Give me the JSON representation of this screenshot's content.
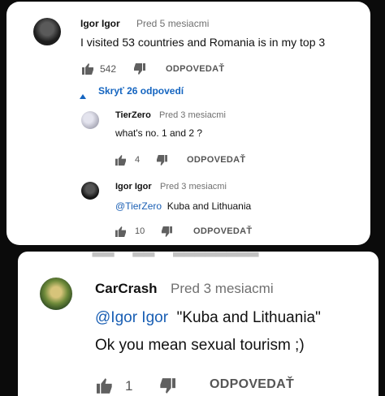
{
  "comment": {
    "author": "Igor Igor",
    "time": "Pred 5 mesiacmi",
    "text": "I visited 53 countries and Romania is in my top 3",
    "likes": "542",
    "reply_label": "ODPOVEDAŤ"
  },
  "replies_toggle": {
    "label": "Skryť 26 odpovedí"
  },
  "replies": [
    {
      "author": "TierZero",
      "time": "Pred 3 mesiacmi",
      "text": "what's no. 1 and 2 ?",
      "likes": "4",
      "reply_label": "ODPOVEDAŤ"
    },
    {
      "author": "Igor Igor",
      "time": "Pred 3 mesiacmi",
      "mention": "@TierZero",
      "text": "Kuba and Lithuania",
      "likes": "10",
      "reply_label": "ODPOVEDAŤ"
    }
  ],
  "second_comment": {
    "author": "CarCrash",
    "time": "Pred 3 mesiacmi",
    "mention": "@Igor Igor",
    "quote": "\"Kuba and Lithuania\"",
    "text": "Ok you mean sexual tourism ;)",
    "likes": "1",
    "reply_label": "ODPOVEDAŤ"
  },
  "colors": {
    "mention": "#1a5fb4",
    "toggle": "#1565c0",
    "background": "#0b0b0b",
    "card": "#ffffff"
  },
  "icons": [
    "thumbs-up-icon",
    "thumbs-down-icon",
    "caret-up-icon"
  ]
}
